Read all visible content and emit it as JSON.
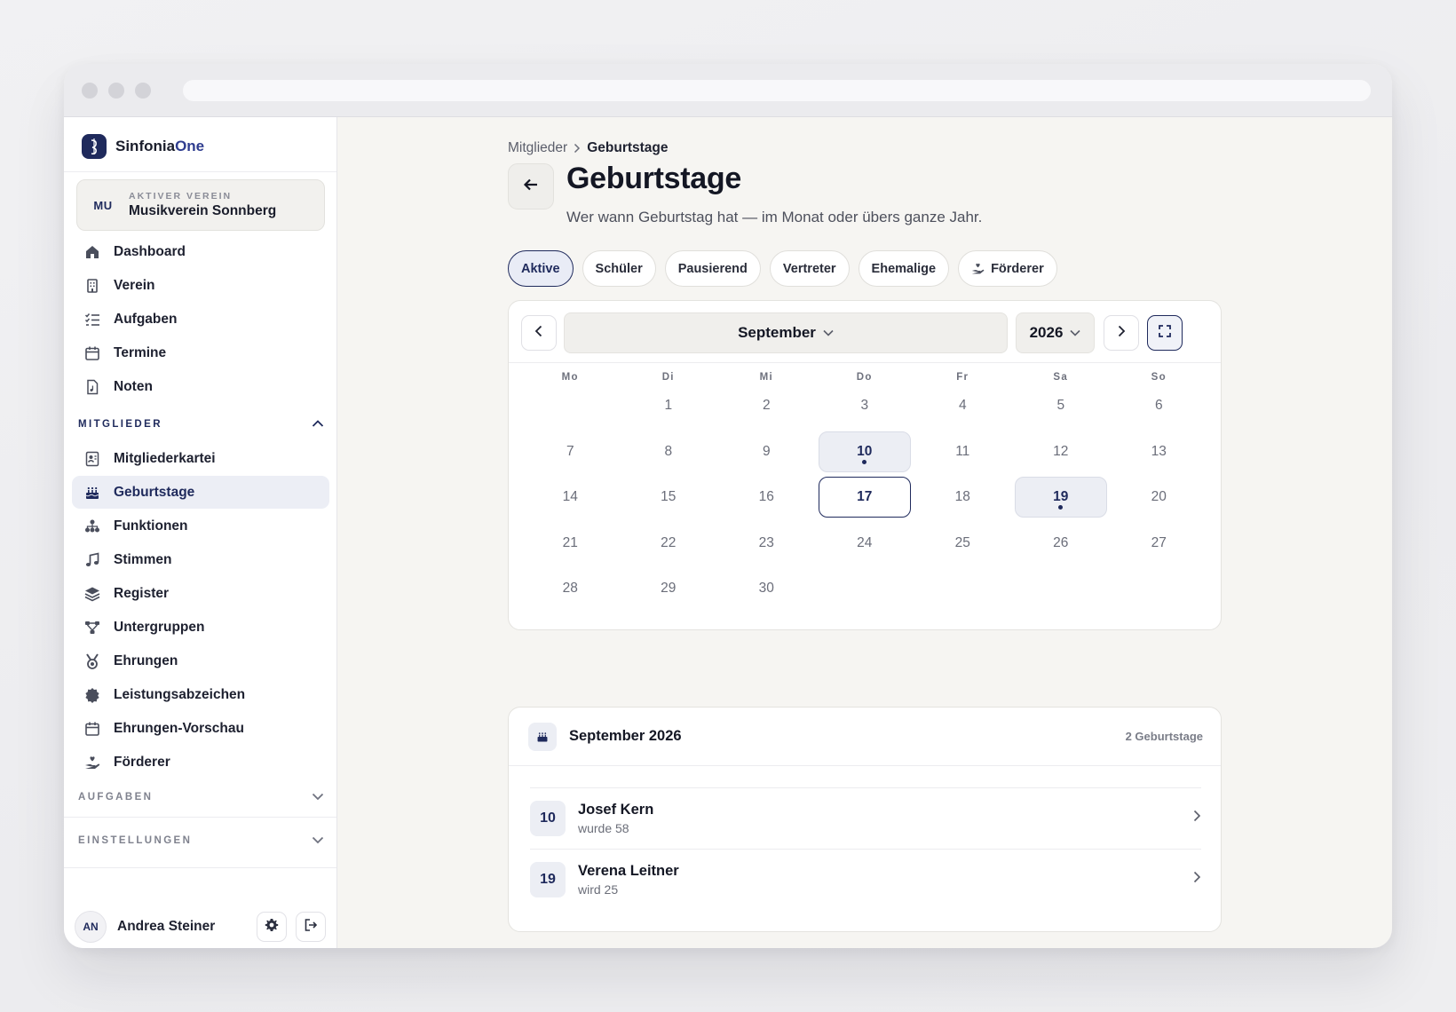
{
  "brand": {
    "name_plain": "Sinfonia",
    "name_accent": "One"
  },
  "club": {
    "badge": "MU",
    "kicker": "AKTIVER VEREIN",
    "name": "Musikverein Sonnberg"
  },
  "nav_main": [
    {
      "label": "Dashboard",
      "icon": "home-icon"
    },
    {
      "label": "Verein",
      "icon": "building-icon"
    },
    {
      "label": "Aufgaben",
      "icon": "checklist-icon"
    },
    {
      "label": "Termine",
      "icon": "calendar-icon"
    },
    {
      "label": "Noten",
      "icon": "sheet-music-icon"
    }
  ],
  "section_members": {
    "label": "MITGLIEDER",
    "expanded": true
  },
  "nav_members": [
    {
      "label": "Mitgliederkartei",
      "icon": "contact-card-icon"
    },
    {
      "label": "Geburtstage",
      "icon": "cake-icon",
      "active": true
    },
    {
      "label": "Funktionen",
      "icon": "org-chart-icon"
    },
    {
      "label": "Stimmen",
      "icon": "music-note-icon"
    },
    {
      "label": "Register",
      "icon": "layers-icon"
    },
    {
      "label": "Untergruppen",
      "icon": "subgroups-icon"
    },
    {
      "label": "Ehrungen",
      "icon": "medal-icon"
    },
    {
      "label": "Leistungsabzeichen",
      "icon": "badge-icon"
    },
    {
      "label": "Ehrungen-Vorschau",
      "icon": "calendar-icon"
    },
    {
      "label": "Förderer",
      "icon": "hand-heart-icon"
    }
  ],
  "section_tasks": {
    "label": "AUFGABEN"
  },
  "section_settings": {
    "label": "EINSTELLUNGEN"
  },
  "user": {
    "initials": "AN",
    "name": "Andrea Steiner"
  },
  "breadcrumb": {
    "parent": "Mitglieder",
    "current": "Geburtstage"
  },
  "page": {
    "title": "Geburtstage",
    "subtitle": "Wer wann Geburtstag hat — im Monat oder übers ganze Jahr."
  },
  "filters": [
    {
      "label": "Aktive",
      "active": true
    },
    {
      "label": "Schüler"
    },
    {
      "label": "Pausierend"
    },
    {
      "label": "Vertreter"
    },
    {
      "label": "Ehemalige"
    },
    {
      "label": "Förderer",
      "icon": "hand-heart-icon"
    }
  ],
  "calendar": {
    "month": "September",
    "year": "2026",
    "weekdays": [
      "Mo",
      "Di",
      "Mi",
      "Do",
      "Fr",
      "Sa",
      "So"
    ],
    "first_weekday_index": 1,
    "days_in_month": 30,
    "today": 17,
    "birthday_days": [
      10,
      19
    ]
  },
  "list": {
    "title": "September 2026",
    "count": "2 Geburtstage",
    "rows": [
      {
        "day": "10",
        "name": "Josef Kern",
        "meta": "wurde 58"
      },
      {
        "day": "19",
        "name": "Verena Leitner",
        "meta": "wird 25"
      }
    ]
  },
  "colors": {
    "accent": "#1f2a5c",
    "page_bg": "#f6f5f2"
  }
}
